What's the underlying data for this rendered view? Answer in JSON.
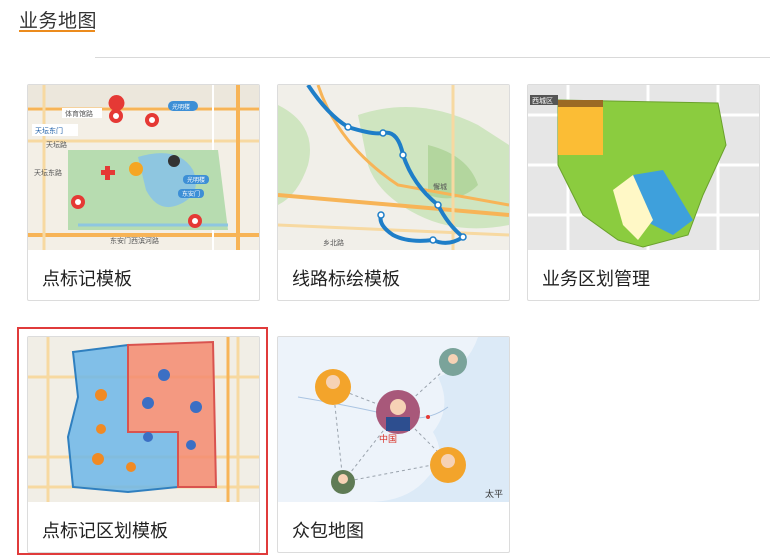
{
  "header": {
    "title": "业务地图"
  },
  "templates": [
    {
      "label": "点标记模板",
      "map_labels": [
        "体育馆路",
        "光明楼",
        "天坛东门",
        "天坛路",
        "天坛东路",
        "光明楼",
        "东安门",
        "东安门西滨河路"
      ]
    },
    {
      "label": "线路标绘模板",
      "map_labels": [
        "懈城",
        "乡北路"
      ]
    },
    {
      "label": "业务区划管理",
      "map_labels": [
        "西城区"
      ]
    },
    {
      "label": "点标记区划模板",
      "map_labels": []
    },
    {
      "label": "众包地图",
      "map_labels": [
        "中国",
        "太平"
      ]
    }
  ],
  "selected_index": 3,
  "colors": {
    "accent": "#ec8b1d",
    "selected_border": "#e03b3b",
    "region_blue": "#6db6e8",
    "region_red": "#f58a6e",
    "region_green": "#8bc34a",
    "region_yellow": "#fbbd35"
  }
}
